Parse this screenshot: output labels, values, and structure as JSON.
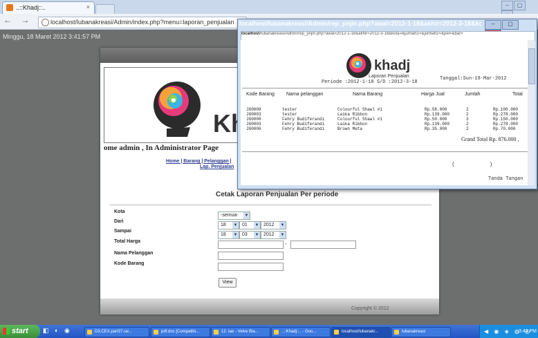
{
  "browser": {
    "tab_title": "..::Khadj::..",
    "tab_close": "×",
    "nav_glyphs": "← → C",
    "url": "localhost/lubanakreasi/Admin/index.php?menu=laporan_penjualan",
    "window_controls": [
      "–",
      "▢",
      "×"
    ]
  },
  "page": {
    "date_text": "Minggu, 18 Maret 2012 3:41:57 PM",
    "brand_big": "Kh",
    "welcome": "ome admin , In Administrator Page",
    "menu_line1": "Home | Barang | Pelanggan |",
    "menu_line2": "Lap. Penjualan",
    "form_title": "Cetak Laporan Penjualan Per periode",
    "fields": {
      "kota_label": "Kota",
      "kota_value": "-semua-",
      "dari_label": "Dari",
      "dari_day": "18",
      "dari_month": "01",
      "dari_year": "2012",
      "sampai_label": "Sampai",
      "sampai_day": "18",
      "sampai_month": "03",
      "sampai_year": "2012",
      "total_label": "Total Harga",
      "total_sep": "-",
      "nama_label": "Nama Pelanggan",
      "kode_label": "Kode Barang"
    },
    "view_button": "View",
    "copyright": "Copyright © 2012"
  },
  "popup": {
    "title": "localhost/lubanakreasi/Admin/rep_pnjln.php?awal=2012-1-18&akhir=2012-3-18&kota=&j...",
    "address_host": "localhost",
    "address_rest": "/lubanakreasi/Admin/rep_pnjln.php?awal=2012-1-18&akhir=2012-3-18&kota=&jumlah1=&jumlah2=&pel=&bar=",
    "controls": [
      "–",
      "▢",
      "X"
    ],
    "report": {
      "brand": "khadj",
      "title": "Laporan Penjualan",
      "periode": "Periode :2012-1-18 S/D :2012-3-18",
      "tanggal": "Tanggal:Sun-18-Mar-2012",
      "headers": [
        "Kode Barang",
        "Nama pelanggan",
        "Nama Barang",
        "Harga Jual",
        "Jumlah",
        "Total"
      ],
      "rows": [
        [
          "JG0008",
          "tester",
          "Colourful Shawl #1",
          "Rp.58.000",
          "2",
          "Rp.100.000"
        ],
        [
          "JG0003",
          "tester",
          "Laika Ribbon",
          "Rp.139.000",
          "2",
          "Rp.278.000"
        ],
        [
          "JG0008",
          "Fehry Budiferandi",
          "Colourful Shawl #1",
          "Rp.50.000",
          "3",
          "Rp.150.000"
        ],
        [
          "JG0003",
          "Fehry Budiferandi",
          "Laika Ribbon",
          "Rp.139.000",
          "2",
          "Rp.278.000"
        ],
        [
          "JG0006",
          "Fehry Budiferandi",
          "Brown Meta",
          "Rp.35.000",
          "2",
          "Rp.70.000"
        ]
      ],
      "grand_total": "Grand Total Rp. 876.000 ,",
      "paren": "( )",
      "signature": "Tanda Tangan"
    }
  },
  "taskbar": {
    "start": "start",
    "tasks": [
      "D3.CEX.part37.rar...",
      "pdf.doc [Compatibi...",
      "12. tae - Velve Bla...",
      "..::Khadj::.. - Goo...",
      "localhost/lubanakr...",
      "lubanakreasi"
    ],
    "clock": "3:43 PM"
  }
}
